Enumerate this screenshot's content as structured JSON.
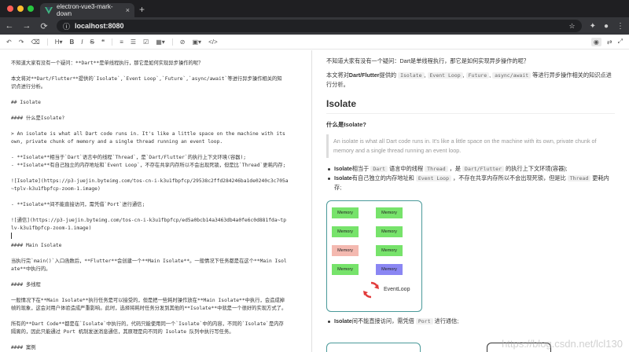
{
  "browser": {
    "tab_title": "electron-vue3-mark-down",
    "tab_close": "×",
    "new_tab": "+",
    "url": "localhost:8080",
    "nav_back": "←",
    "nav_forward": "→",
    "nav_reload": "⟳",
    "lights": [
      "#ff5f57",
      "#febc2e",
      "#28c840"
    ]
  },
  "toolbar": {
    "undo": "↶",
    "redo": "↷",
    "clear": "⌫",
    "heading": "H▾",
    "bold": "B",
    "italic": "I",
    "strike": "S",
    "quote": "❝",
    "ul": "≡",
    "ol": "☰",
    "task": "☑",
    "table": "▦▾",
    "link": "⊘",
    "image": "▣▾",
    "code": "</>",
    "preview": "◉",
    "sync": "⇄",
    "fullscreen": "⤢"
  },
  "editor": {
    "lines": [
      "不知道大家有没有一个疑问：**Dart**是单线程执行，那它是如何实现异步操作的呢？",
      "",
      "本文将对**Dart/Flutter**提供的`Isolate`,`Event Loop`,`Future`,`async/await`等进行异步操作相关的知",
      "识点进行分析。",
      "",
      "## Isolate",
      "",
      "#### 什么是Isolate?",
      "",
      "> An isolate is what all Dart code runs in. It's like a little space on the machine with its",
      "own, private chunk of memory and a single thread running an event loop.",
      "",
      "- **Isolate**相当于`Dart`语言中的线程`Thread`，是`Dart/Flutter`的执行上下文环境(容器);",
      "- **Isolate**有自己独立的内存地址和`Event Loop`，不存在共享内存所以不会出现死锁，但是比`Thread`更耗内存;",
      "",
      "![Isolate](https://p3-juejin.byteimg.com/tos-cn-i-k3u1fbpfcp/29538c2ffd284246ba1de0240c3c705a",
      "~tplv-k3u1fbpfcp-zoom-1.image)",
      "",
      "- **Isolate**间不能直接访问，需凭借`Port`进行通信;",
      "",
      "![通信](https://p3-juejin.byteimg.com/tos-cn-i-k3u1fbpfcp/ed5a0bcb14a3463db4a0fe6c0d881fda~tp",
      "lv-k3u1fbpfcp-zoom-1.image)",
      "",
      "#### Main Isolate",
      "",
      "当执行完`main()`入口函数后，**Flutter**会创建一个**Main Isolate**。一般情况下任务都是在这个**Main Isol",
      "ate**中执行的。",
      "",
      "#### 多线程",
      "",
      "一般情况下在**Main Isolate**执行任务是可以接受的，但是把一些耗时操作放在**Main Isolate**中执行，会造成掉",
      "帧的现象，这会对用户体验造成严重影响。此时，选择将耗时任务分发到其他的**Isolate**中就是一个很好的实现方式了。",
      "",
      "所有的**Dart Code**都是在`Isolate`中执行的，代码只能使用同一个`Isolate`中的内容，不同的`Isolate`是内存",
      "隔离的，因此只能通过 Port 机制发送消息通信，其原理是向不同的 Isolate 队列中执行写任务。",
      "",
      "#### 案例"
    ]
  },
  "preview": {
    "intro1_pre": "不知道大家有没有一个疑问：Dart是单线程执行，那它是如何实现异步操作的呢？",
    "intro2_a": "本文将对",
    "intro2_b": "Dart/Flutter",
    "intro2_c": "提供的",
    "codes1": [
      "Isolate",
      "Event Loop",
      "Future",
      "async/await"
    ],
    "intro2_d": "等进行异步操作相关的知识点进行分析。",
    "h2": "Isolate",
    "h4": "什么是Isolate?",
    "quote": "An isolate is what all Dart code runs in. It's like a little space on the machine with its own, private chunk of memory and a single thread running an event loop.",
    "li1_a": "Isolate",
    "li1_b": "相当于",
    "li1_c1": "Dart",
    "li1_d": "语言中的线程",
    "li1_c2": "Thread",
    "li1_e": "，是",
    "li1_c3": "Dart/Flutter",
    "li1_f": "的执行上下文环境(容器);",
    "li2_a": "Isolate",
    "li2_b": "有自己独立的内存地址和",
    "li2_c1": "Event Loop",
    "li2_d": "，不存在共享内存所以不会出现死锁，但是比",
    "li2_c2": "Thread",
    "li2_e": "更耗内存;",
    "li3_a": "Isolate",
    "li3_b": "间不能直接访问，需凭借",
    "li3_c": "Port",
    "li3_d": "进行通信;",
    "diagram": {
      "cell_label": "Memory",
      "colors": [
        "#77e36b",
        "#77e36b",
        "#77e36b",
        "#77e36b",
        "#f4b9b0",
        "#77e36b",
        "#77e36b",
        "#8a86f3"
      ],
      "event_loop": "EventLoop"
    },
    "watermark": "https://blog.csdn.net/lcl130"
  }
}
